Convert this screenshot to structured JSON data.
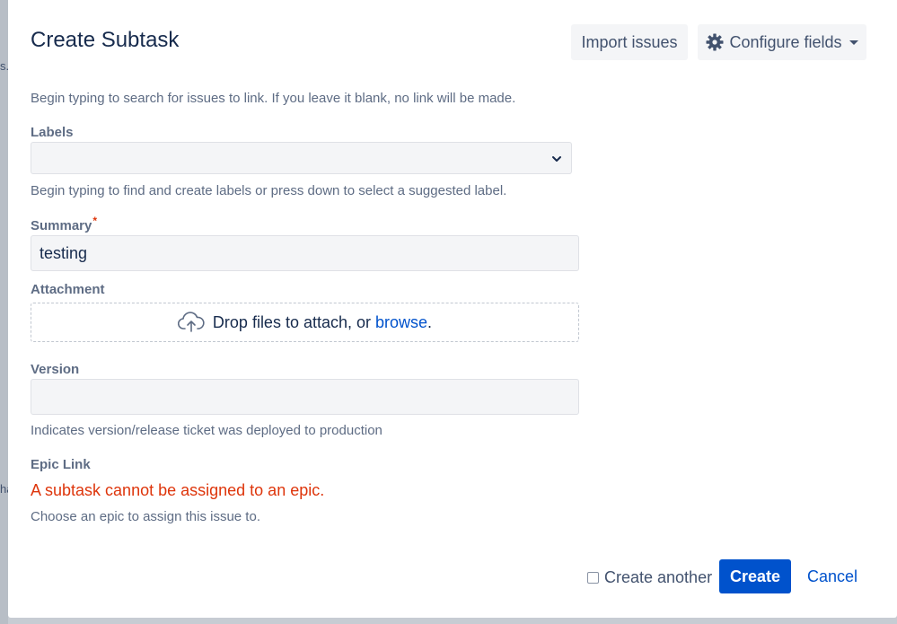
{
  "backdrop": {
    "edge_char_1": "s.",
    "edge_char_2": "ha"
  },
  "dialog": {
    "title": "Create Subtask",
    "header_buttons": {
      "import": "Import issues",
      "configure": "Configure fields"
    },
    "issue_link_help": "Begin typing to search for issues to link. If you leave it blank, no link will be made.",
    "labels": {
      "label": "Labels",
      "value": "",
      "help": "Begin typing to find and create labels or press down to select a suggested label."
    },
    "summary": {
      "label": "Summary",
      "required_marker": "*",
      "value": "testing"
    },
    "attachment": {
      "label": "Attachment",
      "drop_text": "Drop files to attach, or ",
      "browse_link": "browse",
      "drop_suffix": "."
    },
    "version": {
      "label": "Version",
      "value": "",
      "help": "Indicates version/release ticket was deployed to production"
    },
    "epic_link": {
      "label": "Epic Link",
      "error": "A subtask cannot be assigned to an epic.",
      "help": "Choose an epic to assign this issue to."
    },
    "footer": {
      "create_another": "Create another",
      "create_another_checked": false,
      "create": "Create",
      "cancel": "Cancel"
    }
  },
  "colors": {
    "primary": "#0052cc",
    "error": "#de350b",
    "text": "#172b4d",
    "subtle_text": "#5e6c84",
    "field_bg": "#f4f5f7"
  },
  "icons": {
    "configure": "gear-icon",
    "labels_dropdown": "chevron-down-icon",
    "attachment": "cloud-upload-icon"
  }
}
